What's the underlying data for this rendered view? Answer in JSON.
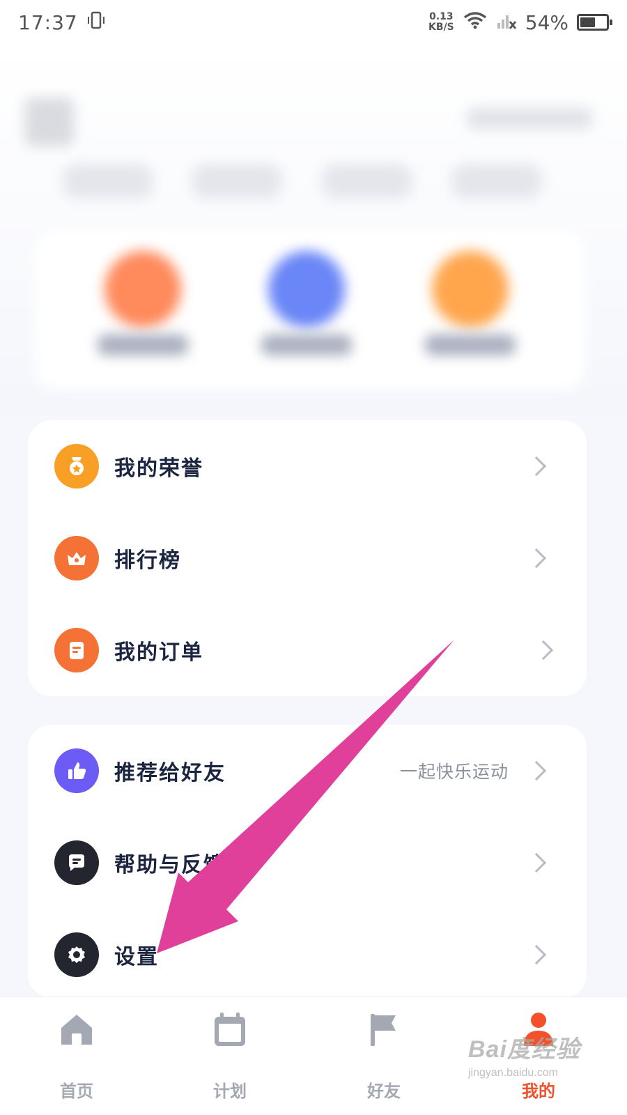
{
  "status_bar": {
    "time": "17:37",
    "net_speed_value": "0.13",
    "net_speed_unit": "KB/S",
    "battery": "54%",
    "battery_level": 0.54
  },
  "menu_group_1": [
    {
      "label": "我的荣誉",
      "icon": "medal-icon",
      "color": "#f7a025"
    },
    {
      "label": "排行榜",
      "icon": "crown-icon",
      "color": "#f57236"
    },
    {
      "label": "我的订单",
      "icon": "clipboard-icon",
      "color": "#f57236"
    }
  ],
  "menu_group_2": [
    {
      "label": "推荐给好友",
      "sub": "一起快乐运动",
      "icon": "thumbs-up-icon",
      "color": "#6c5cf5"
    },
    {
      "label": "帮助与反馈",
      "icon": "chat-icon",
      "color": "#23262e"
    },
    {
      "label": "设置",
      "icon": "gear-icon",
      "color": "#23262e"
    }
  ],
  "bottom_nav": [
    {
      "label": "首页",
      "icon": "home-icon",
      "active": false
    },
    {
      "label": "计划",
      "icon": "calendar-icon",
      "active": false
    },
    {
      "label": "好友",
      "icon": "flag-icon",
      "active": false
    },
    {
      "label": "我的",
      "icon": "person-icon",
      "active": true
    }
  ],
  "colors": {
    "accent": "#f2512b",
    "annotation_arrow": "#e0409a",
    "inactive_nav": "#a3a8b3"
  },
  "watermark": {
    "main": "Bai度经验",
    "sub": "jingyan.baidu.com"
  }
}
